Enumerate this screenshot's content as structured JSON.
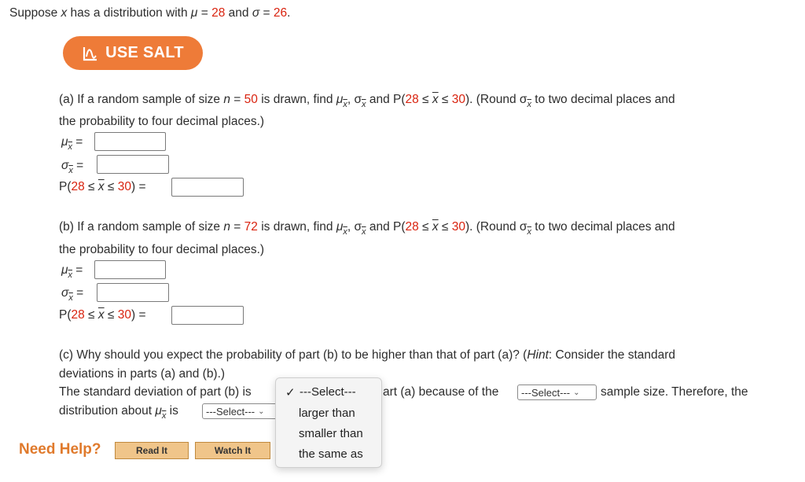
{
  "intro": {
    "text": "Suppose ",
    "var": "x",
    "mid": " has a distribution with ",
    "mu_sym": "μ",
    "eq1": " = ",
    "mu": "28",
    "and": " and ",
    "sigma_sym": "σ",
    "eq2": " = ",
    "sigma": "26",
    "end": "."
  },
  "salt_button": {
    "label": "USE SALT"
  },
  "part_a": {
    "prefix": "(a) If a random sample of size ",
    "n_sym": "n",
    "eq": " = ",
    "n": "50",
    "find": " is drawn, find ",
    "mid": ", σ",
    "and_p": " and P(",
    "lo": "28",
    "le1": " ≤ ",
    "le2": " ≤ ",
    "hi": "30",
    "round": "). (Round σ",
    "round_end": " to two decimal places and",
    "line2": "the probability to four decimal places.)"
  },
  "part_b": {
    "prefix": "(b) If a random sample of size ",
    "n_sym": "n",
    "eq": " = ",
    "n": "72",
    "find": " is drawn, find ",
    "mid": ", σ",
    "and_p": " and P(",
    "lo": "28",
    "le1": " ≤ ",
    "le2": " ≤ ",
    "hi": "30",
    "round": "). (Round σ",
    "round_end": " to two decimal places and",
    "line2": "the probability to four decimal places.)"
  },
  "symbols": {
    "mu": "μ",
    "sigma": "σ",
    "xbar": "x",
    "eq": " =",
    "p_open": "P(",
    "le": " ≤ ",
    "p_close": ") ="
  },
  "part_c": {
    "line1_a": "(c) Why should you expect the probability of part (b) to be higher than that of part (a)? (",
    "hint": "Hint",
    "line1_b": ": Consider the standard",
    "line2": "deviations in parts (a) and (b).)",
    "line3_a": "The standard deviation of part (b) is",
    "line3_b": "art (a) because of the",
    "line3_c": "sample size. Therefore, the",
    "line4_a": "distribution about ",
    "line4_b": " is"
  },
  "select_placeholder": "---Select---",
  "dropdown": {
    "selected": "---Select---",
    "checkmark": "✓",
    "options": [
      "larger than",
      "smaller than",
      "the same as"
    ]
  },
  "help": {
    "label": "Need Help?",
    "read_it": "Read It",
    "watch_it": "Watch It"
  },
  "colors": {
    "accent": "#d9230f",
    "salt_orange": "#ee7b38",
    "help_orange": "#e07a2c"
  }
}
